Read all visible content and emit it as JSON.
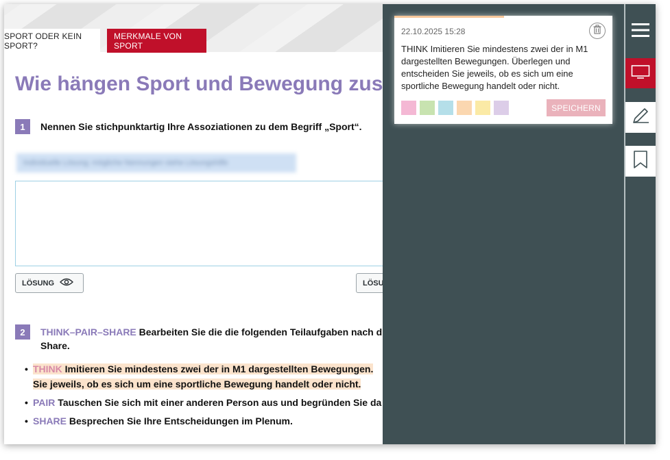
{
  "tabs": {
    "inactive": "SPORT ODER KEIN SPORT?",
    "active": "MERKMALE VON SPORT"
  },
  "main": {
    "title": "Wie hängen Sport und Bewegung zusam",
    "task1": {
      "number": "1",
      "text": "Nennen Sie stichpunktartig Ihre Assoziationen zu dem Begriff „Sport“.",
      "blurred_hint": "Individuelle Lösung; mögliche Nennungen siehe Lösungshilfe"
    },
    "solution_button": "LÖSUNG",
    "solution_button_2": "LÖSU",
    "task2": {
      "number": "2",
      "prefix": "THINK–PAIR–SHARE",
      "text_line1": " Bearbeiten Sie die die folgenden Teilaufgaben nach d",
      "text_line2": "Share."
    },
    "bullets": {
      "think_label": "THINK",
      "think_text_1": " Imitieren Sie mindestens zwei der in M1 dargestellten Bewegungen.",
      "think_text_2": "Sie jeweils, ob es sich um eine sportliche Bewegung handelt oder nicht.",
      "pair_label": "PAIR",
      "pair_text": " Tauschen Sie sich mit einer anderen Person aus und begründen Sie da",
      "share_label": "SHARE",
      "share_text": " Besprechen Sie Ihre Entscheidungen im Plenum."
    }
  },
  "note": {
    "date": "22.10.2025 15:28",
    "text": "THINK Imitieren Sie mindestens zwei der in M1 dargestellten Bewegungen. Überlegen und entscheiden Sie jeweils, ob es sich um eine sportliche Bewegung handelt oder nicht.",
    "save_label": "SPEICHERN",
    "colors": [
      "#f4b8d4",
      "#c8e3b0",
      "#b5dfe9",
      "#fbd7b0",
      "#fbeaa6",
      "#dccde8"
    ]
  },
  "toolbar": {
    "icons": [
      "menu-icon",
      "presentation-icon",
      "pen-icon",
      "bookmark-icon"
    ],
    "accent": "#c0102a"
  }
}
